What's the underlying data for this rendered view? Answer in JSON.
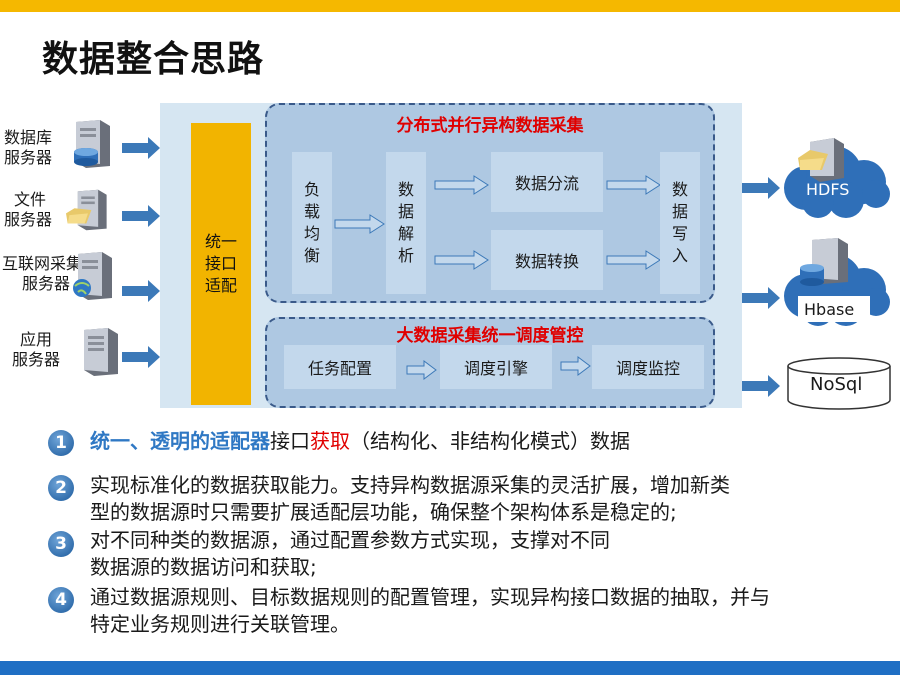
{
  "title": "数据整合思路",
  "servers": [
    {
      "label_lines": [
        "数据库",
        "服务器"
      ],
      "icon": "database-server-icon"
    },
    {
      "label_lines": [
        "文件",
        "服务器"
      ],
      "icon": "file-server-icon"
    },
    {
      "label_lines": [
        "互联网采集",
        "服务器"
      ],
      "icon": "internet-server-icon"
    },
    {
      "label_lines": [
        "应用",
        "服务器"
      ],
      "icon": "application-server-icon"
    }
  ],
  "adapter": "统一\n接口\n适配",
  "collect": {
    "title": "分布式并行异构数据采集",
    "load_balance": "负\n载\n均\n衡",
    "parse": "数\n据\n解\n析",
    "split": "数据分流",
    "convert": "数据转换",
    "write": "数\n据\n写\n入"
  },
  "schedule": {
    "title": "大数据采集统一调度管控",
    "steps": [
      "任务配置",
      "调度引擎",
      "调度监控"
    ]
  },
  "stores": [
    "HDFS",
    "Hbase",
    "NoSql"
  ],
  "bullets": [
    {
      "num": "1",
      "parts": [
        {
          "text": "统一、透明的适配器",
          "style": "hl-blue"
        },
        {
          "text": "接口",
          "style": ""
        },
        {
          "text": "获取",
          "style": "hl-red"
        },
        {
          "text": "（结构化、非结构化模式）数据",
          "style": ""
        }
      ]
    },
    {
      "num": "2",
      "lines": [
        "实现标准化的数据获取能力。支持异构数据源采集的灵活扩展，增加新类",
        "型的数据源时只需要扩展适配层功能，确保整个架构体系是稳定的;"
      ]
    },
    {
      "num": "3",
      "lines": [
        "对不同种类的数据源，通过配置参数方式实现，支撑对不同",
        "数据源的数据访问和获取;"
      ]
    },
    {
      "num": "4",
      "lines": [
        "通过数据源规则、目标数据规则的配置管理，实现异构接口数据的抽取，并与",
        "特定业务规则进行关联管理。"
      ]
    }
  ],
  "colors": {
    "top_bar": "#f5b800",
    "bottom_bar": "#1f6fc4",
    "adapter": "#f2b400",
    "panel": "#d6e6f2",
    "group": "#aec8e2",
    "group_title": "#e00000",
    "highlight_blue": "#2f78c4"
  }
}
